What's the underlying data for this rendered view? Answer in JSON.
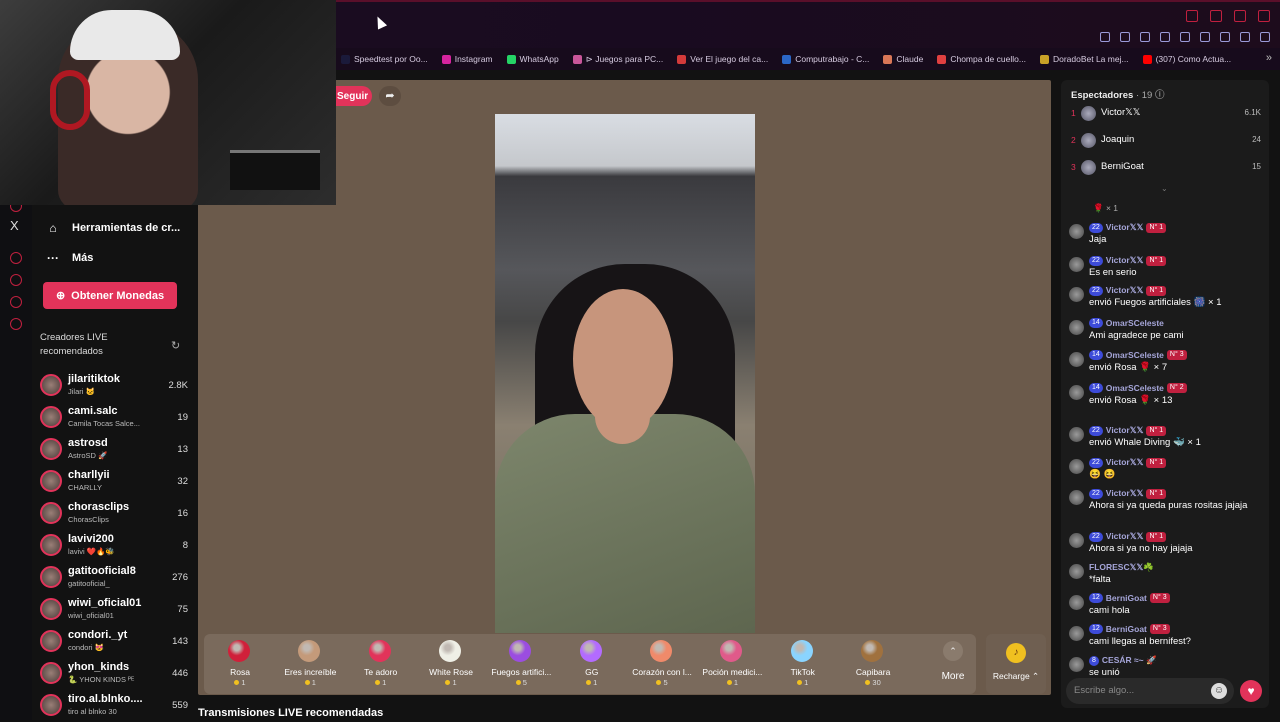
{
  "bookmarks": [
    {
      "label": "Speedtest por Oo...",
      "icon": "speedtest-icon",
      "color": "#1a1a3a"
    },
    {
      "label": "Instagram",
      "icon": "instagram-icon",
      "color": "#d6249f"
    },
    {
      "label": "WhatsApp",
      "icon": "whatsapp-icon",
      "color": "#25d366"
    },
    {
      "label": "⊳ Juegos para PC...",
      "icon": "games-icon",
      "color": "#c9569a"
    },
    {
      "label": "Ver El juego del ca...",
      "icon": "play-icon",
      "color": "#d43a3a"
    },
    {
      "label": "Computrabajo - C...",
      "icon": "computrabajo-icon",
      "color": "#2b67c6"
    },
    {
      "label": "Claude",
      "icon": "claude-icon",
      "color": "#d97757"
    },
    {
      "label": "Chompa de cuello...",
      "icon": "shop-icon",
      "color": "#e04040"
    },
    {
      "label": "DoradoBet La mej...",
      "icon": "doradobet-icon",
      "color": "#c9a227"
    },
    {
      "label": "(307) Como Actua...",
      "icon": "youtube-icon",
      "color": "#ff0000"
    }
  ],
  "sidebar": {
    "x_label": "X",
    "tools_label": "Herramientas de cr...",
    "more_label": "Más",
    "coins_button": "Obtener Monedas",
    "creators_heading": "Creadores LIVE recomendados",
    "creators": [
      {
        "name": "jilaritiktok",
        "sub": "Jilari 🐱",
        "count": "2.8K"
      },
      {
        "name": "cami.salc",
        "sub": "Camila Tocas Salce...",
        "count": "19"
      },
      {
        "name": "astrosd",
        "sub": "AstroSD 🚀",
        "count": "13"
      },
      {
        "name": "charllyii",
        "sub": "CHARLLY",
        "count": "32"
      },
      {
        "name": "chorasclips",
        "sub": "ChorasClips",
        "count": "16"
      },
      {
        "name": "lavivi200",
        "sub": "lavivi ❤️🔥🐝",
        "count": "8"
      },
      {
        "name": "gatitooficial8",
        "sub": "gatitooficial_",
        "count": "276"
      },
      {
        "name": "wiwi_oficial01",
        "sub": "wiwi_oficial01",
        "count": "75"
      },
      {
        "name": "condori._yt",
        "sub": "condori 😻",
        "count": "143"
      },
      {
        "name": "yhon_kinds",
        "sub": "🐍 YHON KINDS ᴾᴱ",
        "count": "446"
      },
      {
        "name": "tiro.al.blnko....",
        "sub": "tiro al blnko 30",
        "count": "559"
      }
    ]
  },
  "stage": {
    "follow_label": "Seguir",
    "share_icon": "share-icon"
  },
  "gifts": [
    {
      "name": "Rosa",
      "price": "1",
      "color": "#d0203a"
    },
    {
      "name": "Eres increíble",
      "price": "1",
      "color": "#c49a7a"
    },
    {
      "name": "Te adoro",
      "price": "1",
      "color": "#e2335a"
    },
    {
      "name": "White Rose",
      "price": "1",
      "color": "#efefe6"
    },
    {
      "name": "Fuegos artifici...",
      "price": "5",
      "color": "#9b4de0"
    },
    {
      "name": "GG",
      "price": "1",
      "color": "#b36bff"
    },
    {
      "name": "Corazón con l...",
      "price": "5",
      "color": "#f08a6a"
    },
    {
      "name": "Poción medici...",
      "price": "1",
      "color": "#e05a8a"
    },
    {
      "name": "TikTok",
      "price": "1",
      "color": "#8ad4ff"
    },
    {
      "name": "Capibara",
      "price": "30",
      "color": "#a0713e"
    }
  ],
  "more_gifts_label": "More",
  "recharge_label": "Recharge ⌃",
  "recommended_title": "Transmisiones LIVE recomendadas",
  "chat": {
    "viewers_label": "Espectadores",
    "viewers_count": "· 19",
    "top_viewers": [
      {
        "rank": "1",
        "name": "Victor𝕏𝕏",
        "count": "6.1K"
      },
      {
        "rank": "2",
        "name": "Joaquin",
        "count": "24"
      },
      {
        "rank": "3",
        "name": "BerniGoat",
        "count": "15"
      }
    ],
    "pinned": "🌹 × 1",
    "messages": [
      {
        "level": "22",
        "user": "Victor𝕏𝕏",
        "fan": "N° 1",
        "text": "Jaja"
      },
      {
        "level": "22",
        "user": "Victor𝕏𝕏",
        "fan": "N° 1",
        "text": "Es en serio"
      },
      {
        "level": "22",
        "user": "Victor𝕏𝕏",
        "fan": "N° 1",
        "text": "envió Fuegos artificiales 🎆 × 1"
      },
      {
        "level": "14",
        "user": "OmarSCeleste",
        "fan": "",
        "text": "Ami agradece pe cami"
      },
      {
        "level": "14",
        "user": "OmarSCeleste",
        "fan": "N° 3",
        "text": "envió Rosa 🌹 × 7"
      },
      {
        "level": "14",
        "user": "OmarSCeleste",
        "fan": "N° 2",
        "text": "envió Rosa 🌹 × 13"
      },
      {
        "level": "22",
        "user": "Victor𝕏𝕏",
        "fan": "N° 1",
        "text": "envió Whale Diving 🐳 × 1"
      },
      {
        "level": "22",
        "user": "Victor𝕏𝕏",
        "fan": "N° 1",
        "text": "😆 😆"
      },
      {
        "level": "22",
        "user": "Victor𝕏𝕏",
        "fan": "N° 1",
        "text": "Ahora si ya queda puras rositas jajaja"
      },
      {
        "level": "22",
        "user": "Victor𝕏𝕏",
        "fan": "N° 1",
        "text": "Ahora si ya no hay jajaja"
      },
      {
        "level": "",
        "user": "FLORESC𝕏𝕏☘️",
        "fan": "",
        "text": "*falta"
      },
      {
        "level": "12",
        "user": "BerniGoat",
        "fan": "N° 3",
        "text": "cami hola"
      },
      {
        "level": "12",
        "user": "BerniGoat",
        "fan": "N° 3",
        "text": "cami llegas al bernifest?"
      },
      {
        "level": "8",
        "user": "CESÁR ≈~ 🚀",
        "fan": "",
        "text": "se unió"
      }
    ],
    "input_placeholder": "Escribe algo...",
    "accent": "#e2335a"
  }
}
